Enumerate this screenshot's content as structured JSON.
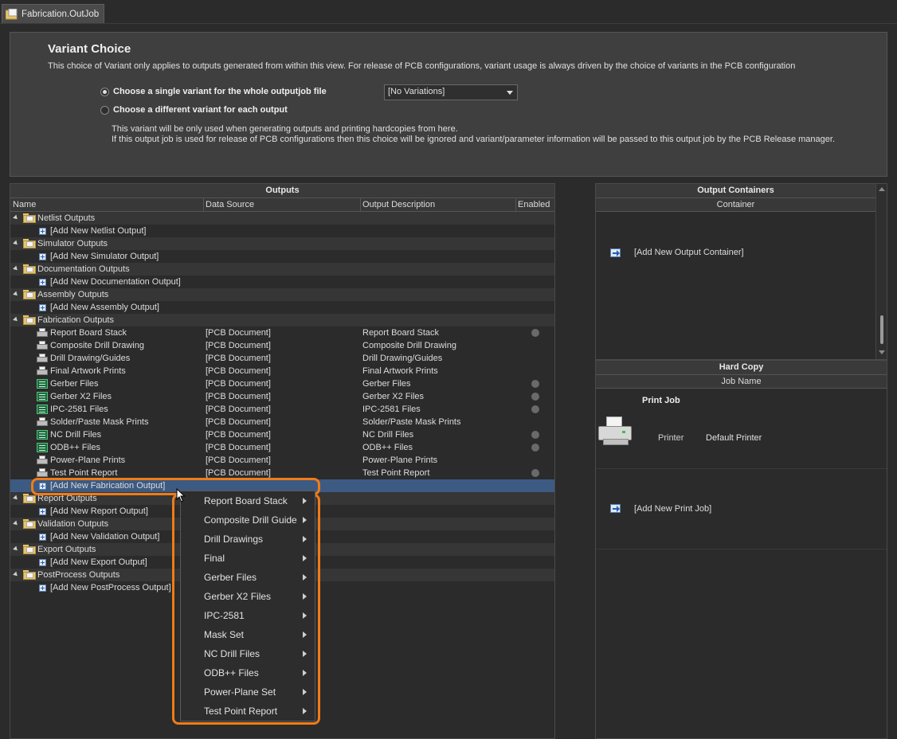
{
  "tab": {
    "title": "Fabrication.OutJob"
  },
  "variant": {
    "title": "Variant Choice",
    "description": "This choice of Variant only applies to outputs generated from within this view. For release of PCB configurations, variant usage is always driven by the choice of variants in the PCB configuration",
    "option_single": "Choose a single variant for the whole outputjob file",
    "option_each": "Choose a different variant for each output",
    "selected_option": "single",
    "combo_value": "[No Variations]",
    "note_line1": "This variant will be only used when generating outputs and printing hardcopies from here.",
    "note_line2": "If this output job is used for release of PCB configurations then this choice will be ignored and variant/parameter information will be passed to this output job by the PCB Release manager."
  },
  "outputs": {
    "title": "Outputs",
    "columns": {
      "name": "Name",
      "source": "Data Source",
      "desc": "Output Description",
      "enabled": "Enabled"
    },
    "groups": [
      {
        "label": "Netlist Outputs",
        "add": "[Add New Netlist Output]",
        "items": []
      },
      {
        "label": "Simulator Outputs",
        "add": "[Add New Simulator Output]",
        "items": []
      },
      {
        "label": "Documentation Outputs",
        "add": "[Add New Documentation Output]",
        "items": []
      },
      {
        "label": "Assembly Outputs",
        "add": "[Add New Assembly Output]",
        "items": []
      },
      {
        "label": "Fabrication Outputs",
        "add": "[Add New Fabrication Output]",
        "items": [
          {
            "name": "Report Board Stack",
            "source": "[PCB Document]",
            "desc": "Report Board Stack",
            "icon": "printer-icon",
            "enabled_dot": true
          },
          {
            "name": "Composite Drill Drawing",
            "source": "[PCB Document]",
            "desc": "Composite Drill Drawing",
            "icon": "printer-icon",
            "enabled_dot": false
          },
          {
            "name": "Drill Drawing/Guides",
            "source": "[PCB Document]",
            "desc": "Drill Drawing/Guides",
            "icon": "printer-icon",
            "enabled_dot": false
          },
          {
            "name": "Final Artwork Prints",
            "source": "[PCB Document]",
            "desc": "Final Artwork Prints",
            "icon": "printer-icon",
            "enabled_dot": false
          },
          {
            "name": "Gerber Files",
            "source": "[PCB Document]",
            "desc": "Gerber Files",
            "icon": "gerber-icon",
            "enabled_dot": true
          },
          {
            "name": "Gerber X2 Files",
            "source": "[PCB Document]",
            "desc": "Gerber X2 Files",
            "icon": "gerber-icon",
            "enabled_dot": true
          },
          {
            "name": "IPC-2581 Files",
            "source": "[PCB Document]",
            "desc": "IPC-2581 Files",
            "icon": "gerber-icon",
            "enabled_dot": true
          },
          {
            "name": "Solder/Paste Mask Prints",
            "source": "[PCB Document]",
            "desc": "Solder/Paste Mask Prints",
            "icon": "printer-icon",
            "enabled_dot": false
          },
          {
            "name": "NC Drill Files",
            "source": "[PCB Document]",
            "desc": "NC Drill Files",
            "icon": "gerber-icon",
            "enabled_dot": true
          },
          {
            "name": "ODB++ Files",
            "source": "[PCB Document]",
            "desc": "ODB++ Files",
            "icon": "gerber-icon",
            "enabled_dot": true
          },
          {
            "name": "Power-Plane Prints",
            "source": "[PCB Document]",
            "desc": "Power-Plane Prints",
            "icon": "printer-icon",
            "enabled_dot": false
          },
          {
            "name": "Test Point Report",
            "source": "[PCB Document]",
            "desc": "Test Point Report",
            "icon": "printer-icon",
            "enabled_dot": true
          }
        ]
      },
      {
        "label": "Report Outputs",
        "add": "[Add New Report Output]",
        "items": []
      },
      {
        "label": "Validation Outputs",
        "add": "[Add New Validation Output]",
        "items": []
      },
      {
        "label": "Export Outputs",
        "add": "[Add New Export Output]",
        "items": []
      },
      {
        "label": "PostProcess Outputs",
        "add": "[Add New PostProcess Output]",
        "items": []
      }
    ]
  },
  "containers": {
    "title": "Output Containers",
    "column": "Container",
    "add": "[Add New Output Container]"
  },
  "hardcopy": {
    "title": "Hard Copy",
    "column": "Job Name",
    "job_title": "Print Job",
    "printer_label": "Printer",
    "printer_value": "Default Printer",
    "add": "[Add New Print Job]"
  },
  "context_menu": {
    "items": [
      "Report Board Stack",
      "Composite Drill Guide",
      "Drill Drawings",
      "Final",
      "Gerber Files",
      "Gerber X2 Files",
      "IPC-2581",
      "Mask Set",
      "NC Drill Files",
      "ODB++ Files",
      "Power-Plane Set",
      "Test Point Report"
    ]
  },
  "colors": {
    "highlight": "#f07b17",
    "selection": "#3c5a82",
    "background": "#2b2b2b"
  }
}
